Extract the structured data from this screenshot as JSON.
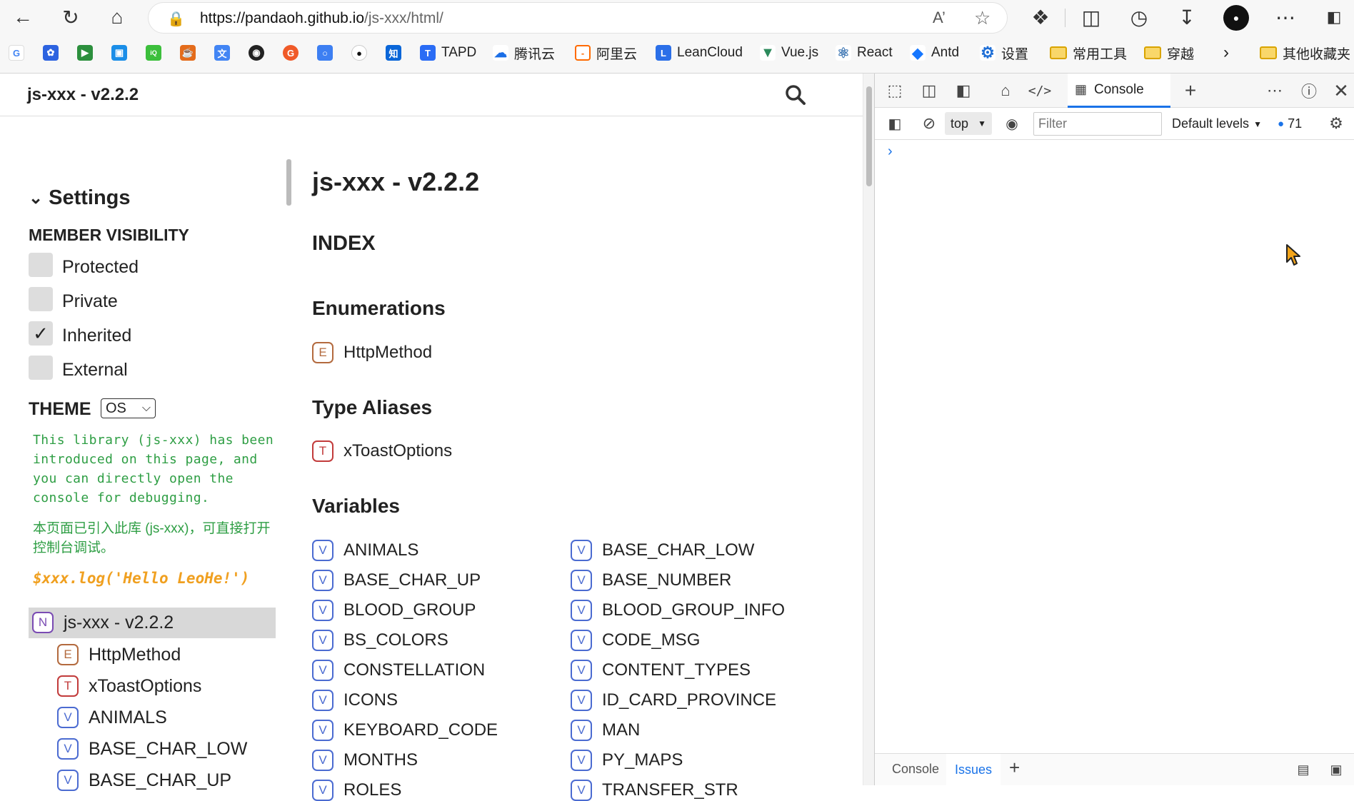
{
  "browser": {
    "url_host": "https://pandaoh.github.io",
    "url_path": "/js-xxx/html/",
    "bookmarks": [
      {
        "label": "TAPD"
      },
      {
        "label": "腾讯云"
      },
      {
        "label": "阿里云"
      },
      {
        "label": "LeanCloud"
      },
      {
        "label": "Vue.js"
      },
      {
        "label": "React"
      },
      {
        "label": "Antd"
      },
      {
        "label": "设置"
      },
      {
        "label": "常用工具"
      },
      {
        "label": "穿越"
      },
      {
        "label": "其他收藏夹"
      }
    ]
  },
  "site": {
    "header_title": "js-xxx - v2.2.2"
  },
  "settings": {
    "heading": "Settings",
    "visibility_heading": "MEMBER VISIBILITY",
    "options": [
      {
        "label": "Protected",
        "checked": false
      },
      {
        "label": "Private",
        "checked": false
      },
      {
        "label": "Inherited",
        "checked": true
      },
      {
        "label": "External",
        "checked": false
      }
    ],
    "theme_label": "THEME",
    "theme_value": "OS",
    "intro_en": "This library (js-xxx) has been introduced on this page, and you can directly open the console for debugging.",
    "intro_zh": "本页面已引入此库 (js-xxx)，可直接打开控制台调试。",
    "code_example": "$xxx.log('Hello LeoHe!')"
  },
  "nav": [
    {
      "kind": "N",
      "label": "js-xxx - v2.2.2"
    },
    {
      "kind": "E",
      "label": "HttpMethod"
    },
    {
      "kind": "T",
      "label": "xToastOptions"
    },
    {
      "kind": "V",
      "label": "ANIMALS"
    },
    {
      "kind": "V",
      "label": "BASE_CHAR_LOW"
    },
    {
      "kind": "V",
      "label": "BASE_CHAR_UP"
    }
  ],
  "main": {
    "title": "js-xxx - v2.2.2",
    "index_heading": "INDEX",
    "enum_heading": "Enumerations",
    "enum_item": "HttpMethod",
    "type_heading": "Type Aliases",
    "type_item": "xToastOptions",
    "var_heading": "Variables",
    "variables_left": [
      "ANIMALS",
      "BASE_CHAR_UP",
      "BLOOD_GROUP",
      "BS_COLORS",
      "CONSTELLATION",
      "ICONS",
      "KEYBOARD_CODE",
      "MONTHS",
      "ROLES"
    ],
    "variables_right": [
      "BASE_CHAR_LOW",
      "BASE_NUMBER",
      "BLOOD_GROUP_INFO",
      "CODE_MSG",
      "CONTENT_TYPES",
      "ID_CARD_PROVINCE",
      "MAN",
      "PY_MAPS",
      "TRANSFER_STR"
    ]
  },
  "devtools": {
    "console_tab": "Console",
    "context": "top",
    "filter_placeholder": "Filter",
    "levels": "Default levels",
    "message_count": "71",
    "bottom_tabs": [
      "Console",
      "Issues"
    ]
  }
}
